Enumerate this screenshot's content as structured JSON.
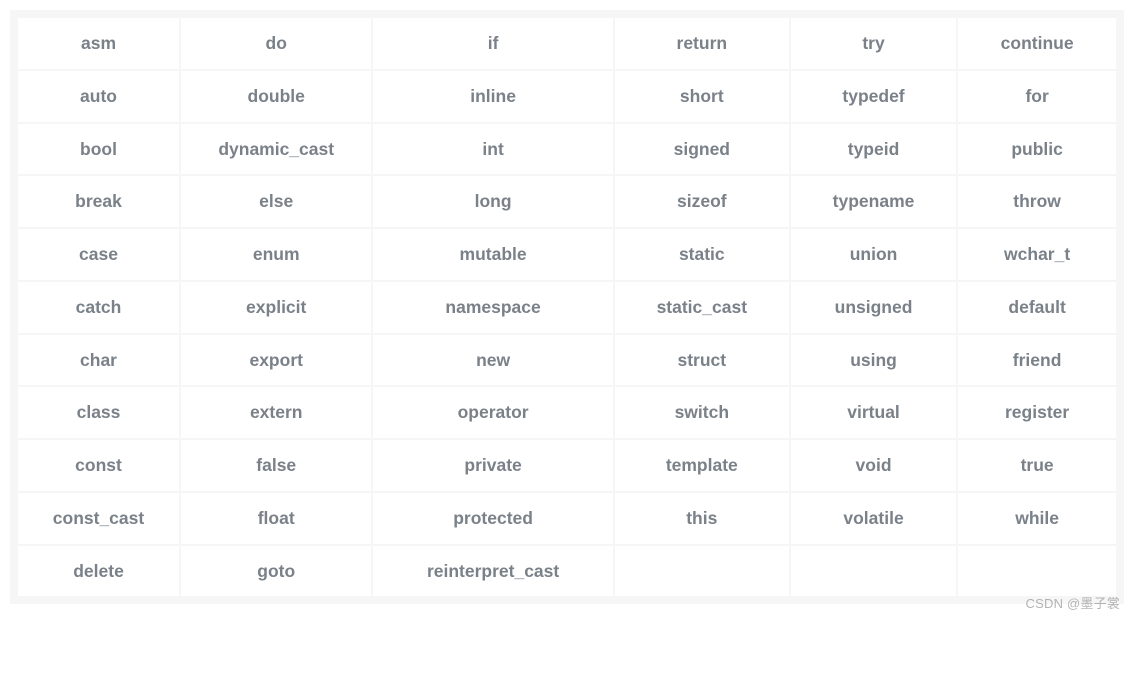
{
  "table": {
    "header": [
      "asm",
      "do",
      "if",
      "return",
      "try",
      "continue"
    ],
    "rows": [
      [
        "auto",
        "double",
        "inline",
        "short",
        "typedef",
        "for"
      ],
      [
        "bool",
        "dynamic_cast",
        "int",
        "signed",
        "typeid",
        "public"
      ],
      [
        "break",
        "else",
        "long",
        "sizeof",
        "typename",
        "throw"
      ],
      [
        "case",
        "enum",
        "mutable",
        "static",
        "union",
        "wchar_t"
      ],
      [
        "catch",
        "explicit",
        "namespace",
        "static_cast",
        "unsigned",
        "default"
      ],
      [
        "char",
        "export",
        "new",
        "struct",
        "using",
        "friend"
      ],
      [
        "class",
        "extern",
        "operator",
        "switch",
        "virtual",
        "register"
      ],
      [
        "const",
        "false",
        "private",
        "template",
        "void",
        "true"
      ],
      [
        "const_cast",
        "float",
        "protected",
        "this",
        "volatile",
        "while"
      ],
      [
        "delete",
        "goto",
        "reinterpret_cast",
        "",
        "",
        ""
      ]
    ]
  },
  "watermark": "CSDN @墨子裳"
}
